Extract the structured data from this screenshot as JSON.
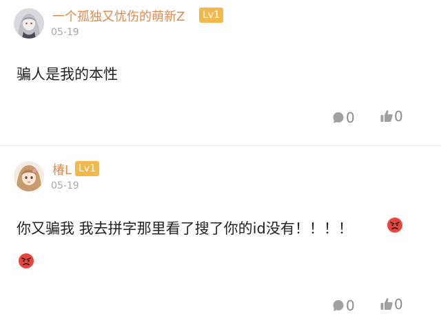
{
  "comments": [
    {
      "username": "一个孤独又忧伤的萌新Z",
      "level": "Lv1",
      "date": "05-19",
      "text": "骗人是我的本性",
      "reply_count": "0",
      "like_count": "0"
    },
    {
      "username": "椿L",
      "level": "Lv1",
      "date": "05-19",
      "text": "你又骗我 我去拼字那里看了搜了你的id没有！！！！",
      "reply_count": "0",
      "like_count": "0"
    }
  ],
  "colors": {
    "username": "#e08a4c",
    "level_badge": "#f2b84a",
    "date": "#a6a6a6",
    "action": "#8a8a8a",
    "angry_emoji": "#e8453c"
  }
}
